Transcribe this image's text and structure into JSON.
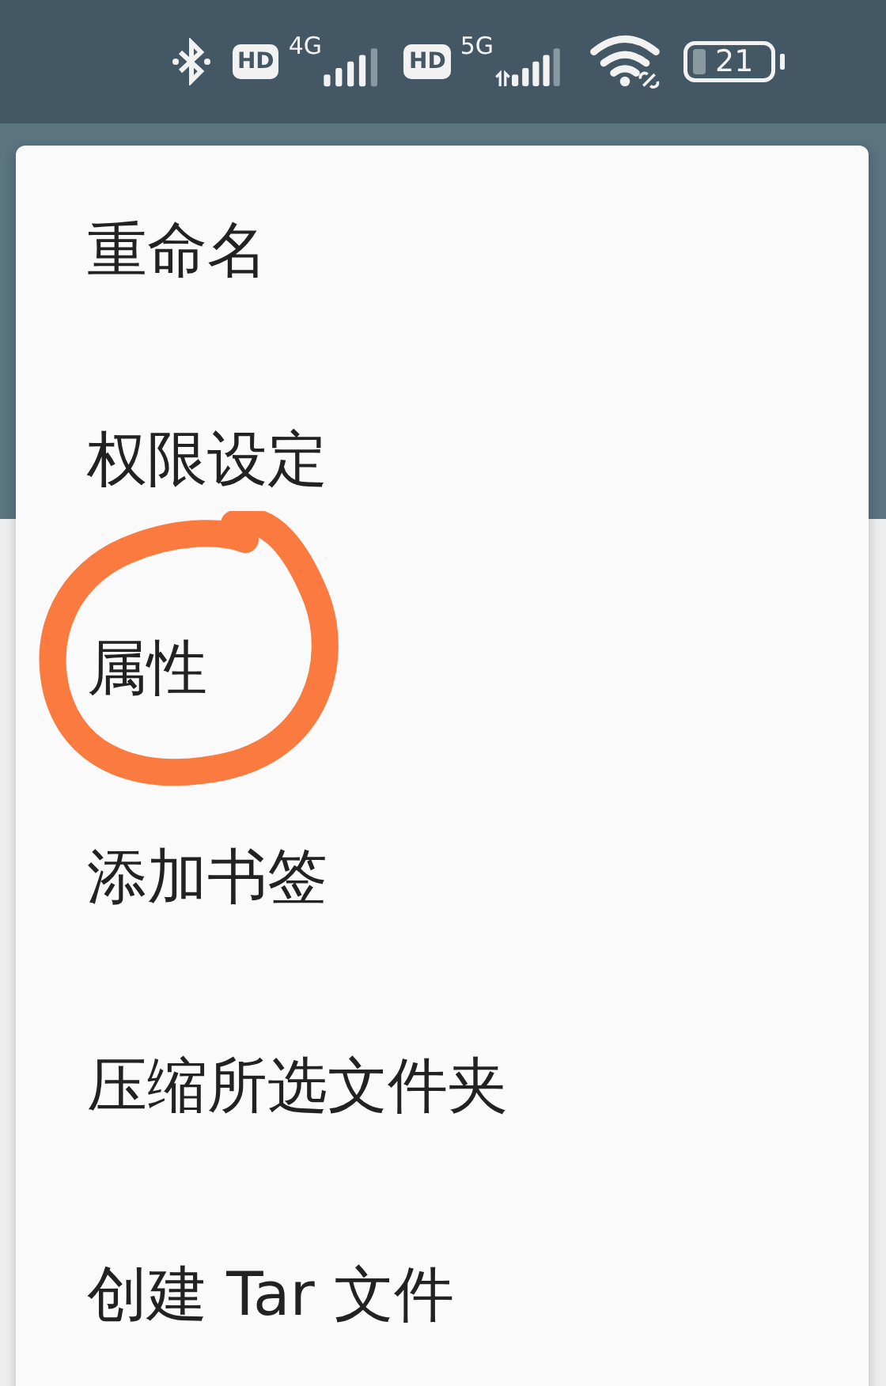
{
  "status_bar": {
    "sim1": {
      "hd": "HD",
      "network": "4G"
    },
    "sim2": {
      "hd": "HD",
      "network": "5G"
    },
    "battery": "21"
  },
  "menu": {
    "items": [
      {
        "label": "重命名",
        "circled": false
      },
      {
        "label": "权限设定",
        "circled": false
      },
      {
        "label": "属性",
        "circled": true
      },
      {
        "label": "添加书签",
        "circled": false
      },
      {
        "label": "压缩所选文件夹",
        "circled": false
      },
      {
        "label": "创建 Tar 文件",
        "circled": false
      }
    ]
  }
}
